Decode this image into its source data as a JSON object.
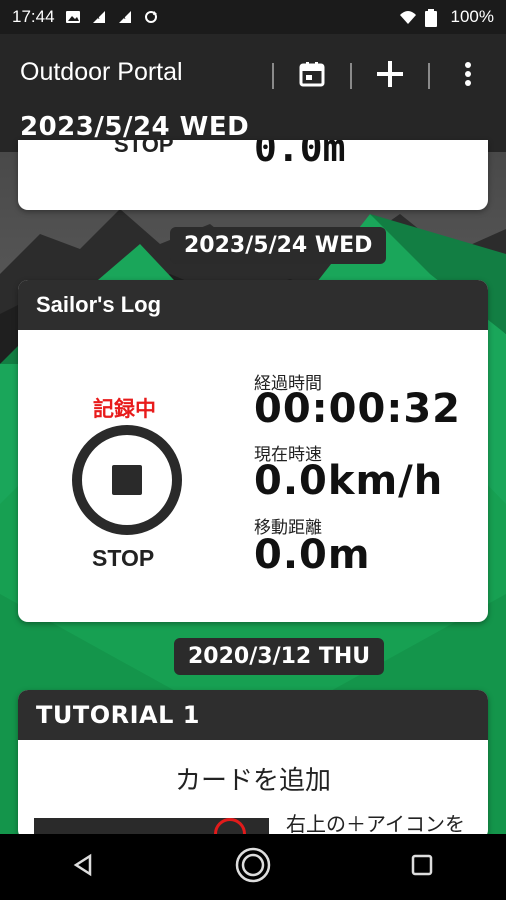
{
  "status_bar": {
    "time": "17:44",
    "battery": "100%",
    "icons": [
      "image-icon",
      "signal-a-icon",
      "signal-a-icon",
      "sync-icon",
      "wifi-icon",
      "battery-icon"
    ]
  },
  "app_bar": {
    "title": "Outdoor Portal",
    "date": "2023/5/24 WED",
    "actions": [
      "calendar-icon",
      "add-icon",
      "more-vert-icon"
    ]
  },
  "top_card": {
    "stop_text": "STOP",
    "value_text": "0.0m"
  },
  "log_section": {
    "date": "2023/5/24 WED",
    "card_title": "Sailor's Log",
    "recording_label": "記録中",
    "stop_label": "STOP",
    "metrics": [
      {
        "label": "経過時間",
        "value": "00:00:32"
      },
      {
        "label": "現在時速",
        "value": "0.0km/h"
      },
      {
        "label": "移動距離",
        "value": "0.0m"
      }
    ]
  },
  "tutorial_section": {
    "date": "2020/3/12 THU",
    "card_title": "TUTORIAL 1",
    "heading": "カードを追加",
    "text": "右上の＋アイコンを",
    "preview_title": "Outdoor Portal"
  },
  "colors": {
    "recording_red": "#e81b1b",
    "green_bg": "#1aa65a",
    "header_dark": "#2e2e2e"
  },
  "nav_bar": [
    "back-icon",
    "home-icon",
    "recents-icon"
  ]
}
